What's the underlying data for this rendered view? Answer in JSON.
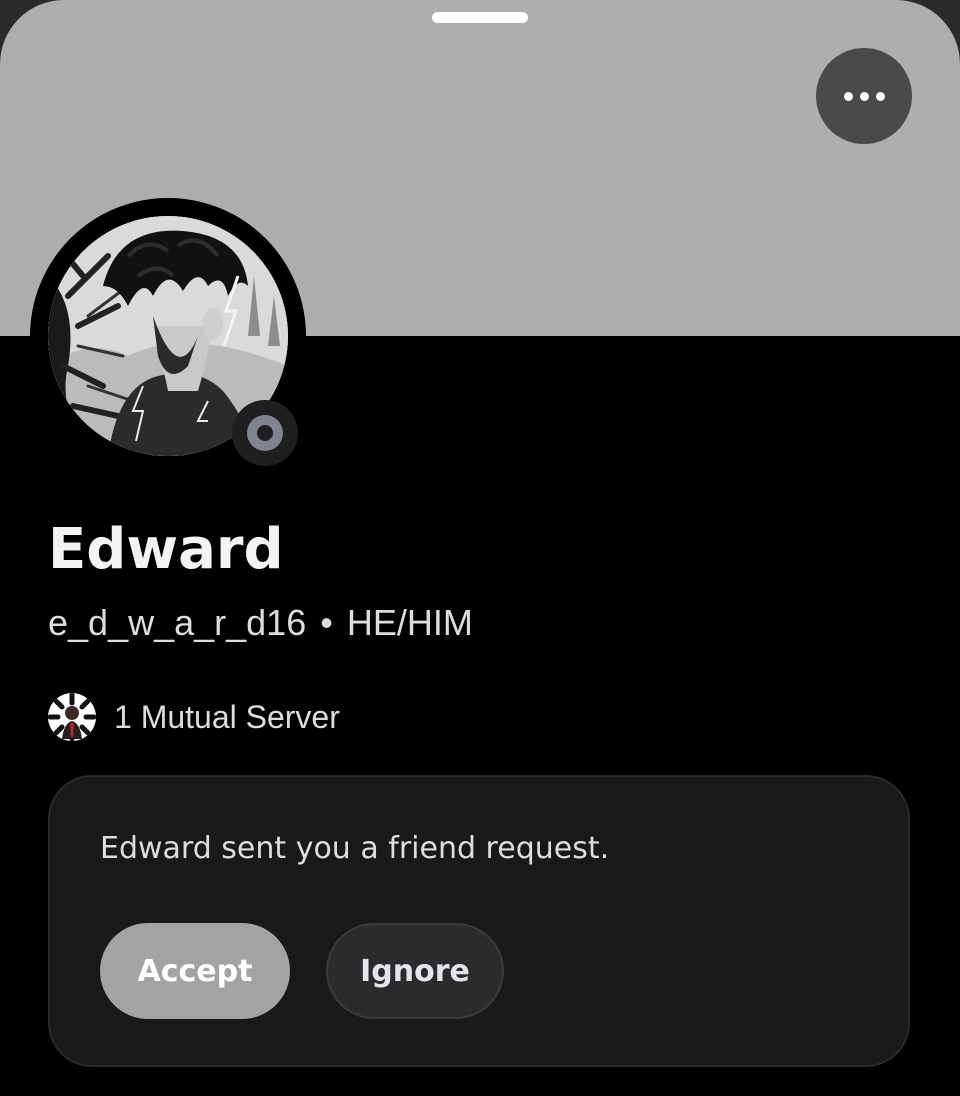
{
  "profile": {
    "display_name": "Edward",
    "username": "e_d_w_a_r_d16",
    "separator": "•",
    "pronouns": "HE/HIM",
    "status": "offline",
    "avatar_icon": "user-avatar-dark-anime-portrait"
  },
  "header": {
    "banner_color": "#afadac",
    "more_icon": "ellipsis-icon"
  },
  "mutual": {
    "label": "1 Mutual Server",
    "server_icon": "server-icon"
  },
  "friend_request": {
    "message": "Edward sent you a friend request.",
    "accept_label": "Accept",
    "ignore_label": "Ignore"
  },
  "colors": {
    "background": "#000000",
    "accept_button": "#a3a3a3",
    "ignore_button": "#2b2b2d",
    "status_offline": "#80848e"
  }
}
